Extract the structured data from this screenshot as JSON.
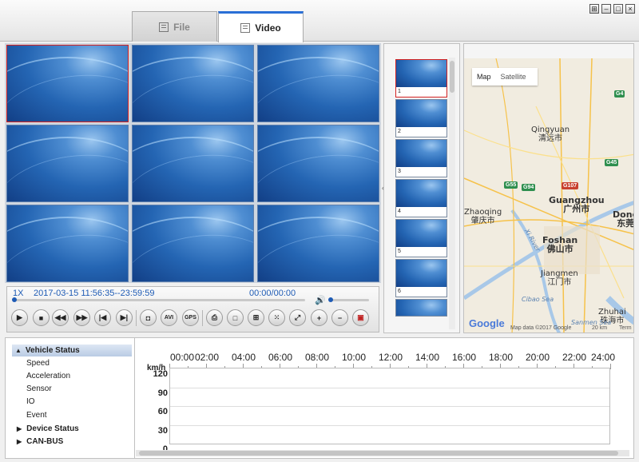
{
  "tabs": [
    {
      "label": "File"
    },
    {
      "label": "Video"
    }
  ],
  "window_buttons": [
    "pin",
    "minimize",
    "maximize",
    "close"
  ],
  "player": {
    "speed": "1X",
    "time_range": "2017-03-15 11:56:35--23:59:59",
    "position": "00:00/00:00",
    "progress": 0,
    "volume": 0,
    "buttons": [
      "play",
      "stop",
      "rewind",
      "fast-forward",
      "previous",
      "next",
      "snapshot",
      "AVI",
      "GPS",
      "print",
      "single-view",
      "quad-view",
      "nine-view",
      "fullscreen",
      "zoom-in",
      "zoom-out",
      "record"
    ]
  },
  "channels": [
    "1",
    "2",
    "3",
    "4",
    "5",
    "6",
    "7",
    "8",
    "9"
  ],
  "selected_channel": "1",
  "thumbnails": [
    {
      "n": "1"
    },
    {
      "n": "2"
    },
    {
      "n": "3"
    },
    {
      "n": "4"
    },
    {
      "n": "5"
    },
    {
      "n": "6"
    }
  ],
  "map": {
    "tabs": [
      "Map",
      "Satellite"
    ],
    "active_tab": "Map",
    "cities": [
      {
        "en": "Qingyuan",
        "zh": "清远市"
      },
      {
        "en": "Guangzhou",
        "zh": "广州市"
      },
      {
        "en": "Zhaoqing",
        "zh": "肇庆市"
      },
      {
        "en": "Foshan",
        "zh": "佛山市"
      },
      {
        "en": "Dong",
        "zh": "东莞"
      },
      {
        "en": "Jiangmen",
        "zh": "江门市"
      },
      {
        "en": "Zhuhai",
        "zh": "珠海市"
      }
    ],
    "river_label": "Xi River",
    "roads": [
      "G4",
      "G45",
      "G107",
      "G55",
      "G94"
    ],
    "labels": {
      "sea": "Sanmen Sea",
      "cibao": "Cibao Sea",
      "logo": "Google",
      "attribution": "Map data ©2017 Google",
      "scale": "20 km",
      "terms": "Term"
    }
  },
  "tree": {
    "items": [
      {
        "label": "Vehicle Status",
        "type": "group",
        "expanded": true
      },
      {
        "label": "Speed",
        "type": "item"
      },
      {
        "label": "Acceleration",
        "type": "item"
      },
      {
        "label": "Sensor",
        "type": "item"
      },
      {
        "label": "IO",
        "type": "item"
      },
      {
        "label": "Event",
        "type": "item"
      },
      {
        "label": "Device Status",
        "type": "group",
        "expanded": false
      },
      {
        "label": "CAN-BUS",
        "type": "group",
        "expanded": false
      }
    ]
  },
  "timeline": {
    "hours": [
      "00:00",
      "02:00",
      "04:00",
      "06:00",
      "08:00",
      "10:00",
      "12:00",
      "14:00",
      "16:00",
      "18:00",
      "20:00",
      "22:00",
      "24:00"
    ],
    "unit": "km/h",
    "y_ticks": [
      "120",
      "90",
      "60",
      "30",
      "0"
    ]
  }
}
